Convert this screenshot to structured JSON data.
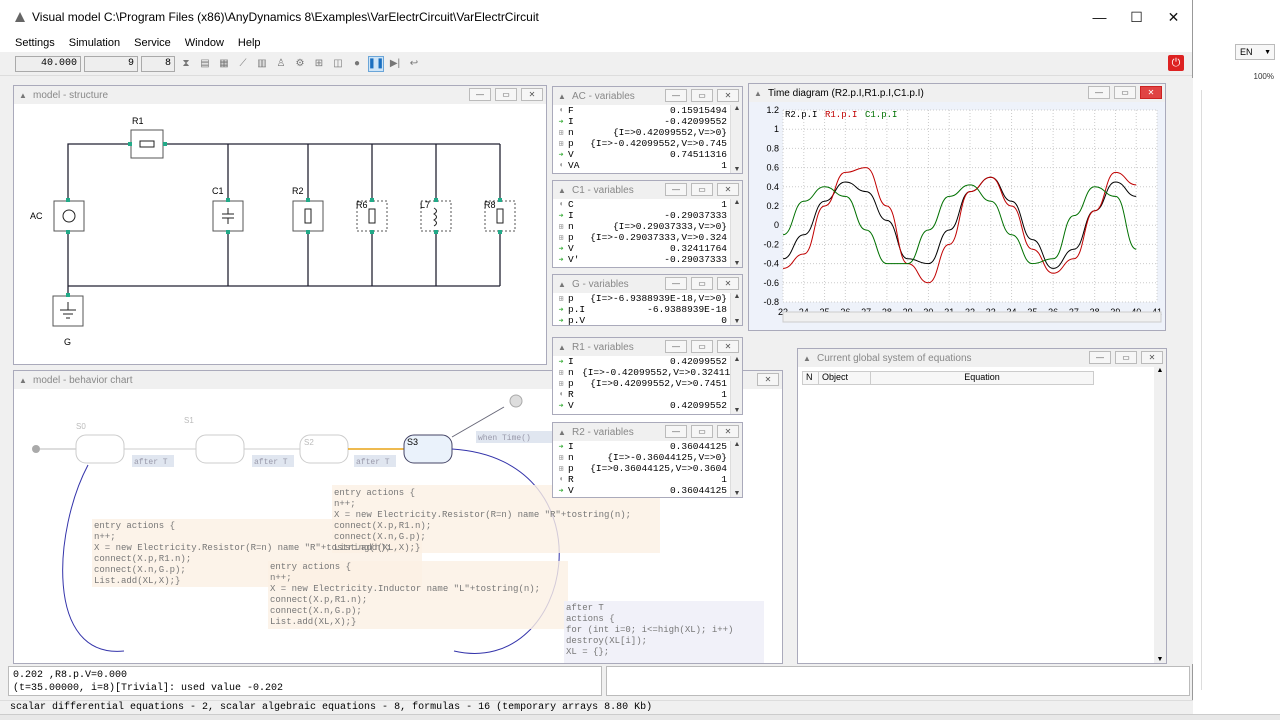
{
  "app": {
    "title": "Visual model C:\\Program Files (x86)\\AnyDynamics 8\\Examples\\VarElectrCircuit\\VarElectrCircuit"
  },
  "window_controls": {
    "minimize": "—",
    "maximize": "☐",
    "close": "✕"
  },
  "menu": [
    "Settings",
    "Simulation",
    "Service",
    "Window",
    "Help"
  ],
  "toolbar": {
    "time": "40.000",
    "field2": "9",
    "field3": "8"
  },
  "structure": {
    "title": "model - structure",
    "components": {
      "r1": "R1",
      "ac": "AC",
      "c1": "C1",
      "r2": "R2",
      "r6": "R6",
      "l7": "L7",
      "r8": "R8",
      "g": "G"
    }
  },
  "behavior": {
    "title": "model - behavior chart",
    "states": [
      "S0",
      "S1",
      "S2",
      "S3"
    ],
    "transitions": [
      "after T",
      "after T",
      "after T",
      "when Time()"
    ],
    "code1": [
      "entry actions {",
      "    n++;",
      "    X = new Electricity.Resistor(R=n) name \"R\"+tostring(n);",
      "    connect(X.p,R1.n);",
      "    connect(X.n,G.p);",
      "    List.add(XL,X);}"
    ],
    "code2": [
      "entry actions {",
      "    n++;",
      "    X = new Electricity.Resistor(R=n) name \"R\"+tostring(n);",
      "    connect(X.p,R1.n);",
      "    connect(X.n,G.p);",
      "    List.add(XL,X);}"
    ],
    "code3": [
      "entry actions {",
      "    n++;",
      "    X = new Electricity.Inductor name \"L\"+tostring(n);",
      "    connect(X.p,R1.n);",
      "    connect(X.n,G.p);",
      "    List.add(XL,X);}"
    ],
    "code4": [
      "after T",
      "actions {",
      "   for (int i=0; i<=high(XL); i++)",
      "     destroy(XL[i]);",
      "   XL = {};"
    ]
  },
  "var_windows": [
    {
      "title": "AC - variables",
      "rows": [
        {
          "icon": "grey",
          "name": "F",
          "value": "0.15915494"
        },
        {
          "icon": "green",
          "name": "I",
          "value": "-0.42099552"
        },
        {
          "icon": "plus",
          "name": "n",
          "value": "{I=>0.42099552,V=>0}"
        },
        {
          "icon": "plus",
          "name": "p",
          "value": "{I=>-0.42099552,V=>0.745"
        },
        {
          "icon": "green",
          "name": "V",
          "value": "0.74511316"
        },
        {
          "icon": "grey",
          "name": "VA",
          "value": "1"
        }
      ]
    },
    {
      "title": "C1 - variables",
      "rows": [
        {
          "icon": "grey",
          "name": "C",
          "value": "1"
        },
        {
          "icon": "green",
          "name": "I",
          "value": "-0.29037333"
        },
        {
          "icon": "plus",
          "name": "n",
          "value": "{I=>0.29037333,V=>0}"
        },
        {
          "icon": "plus",
          "name": "p",
          "value": "{I=>-0.29037333,V=>0.324"
        },
        {
          "icon": "green",
          "name": "V",
          "value": "0.32411764"
        },
        {
          "icon": "green",
          "name": "V'",
          "value": "-0.29037333"
        }
      ]
    },
    {
      "title": "G - variables",
      "rows": [
        {
          "icon": "plus",
          "name": "p",
          "value": "{I=>-6.9388939E-18,V=>0}"
        },
        {
          "icon": "green",
          "name": "p.I",
          "value": "-6.9388939E-18"
        },
        {
          "icon": "green",
          "name": "p.V",
          "value": "0"
        }
      ]
    },
    {
      "title": "R1 - variables",
      "rows": [
        {
          "icon": "green",
          "name": "I",
          "value": "0.42099552"
        },
        {
          "icon": "plus",
          "name": "n",
          "value": "{I=>-0.42099552,V=>0.32411"
        },
        {
          "icon": "plus",
          "name": "p",
          "value": "{I=>0.42099552,V=>0.7451"
        },
        {
          "icon": "grey",
          "name": "R",
          "value": "1"
        },
        {
          "icon": "green",
          "name": "V",
          "value": "0.42099552"
        }
      ]
    },
    {
      "title": "R2 - variables",
      "rows": [
        {
          "icon": "green",
          "name": "I",
          "value": "0.36044125"
        },
        {
          "icon": "plus",
          "name": "n",
          "value": "{I=>-0.36044125,V=>0}"
        },
        {
          "icon": "plus",
          "name": "p",
          "value": "{I=>0.36044125,V=>0.3604"
        },
        {
          "icon": "grey",
          "name": "R",
          "value": "1"
        },
        {
          "icon": "green",
          "name": "V",
          "value": "0.36044125"
        }
      ]
    }
  ],
  "time_diagram": {
    "title": "Time diagram (R2.p.I,R1.p.I,C1.p.I)"
  },
  "chart_data": {
    "type": "line",
    "legend": [
      "R2.p.I",
      "R1.p.I",
      "C1.p.I"
    ],
    "legend_placement": "top-left",
    "xlim": [
      23,
      41
    ],
    "ylim": [
      -0.8,
      1.2
    ],
    "x_ticks": [
      23,
      24,
      25,
      26,
      27,
      28,
      29,
      30,
      31,
      32,
      33,
      34,
      35,
      36,
      37,
      38,
      39,
      40,
      41
    ],
    "y_ticks": [
      "1.2",
      "1",
      "0.8",
      "0.6",
      "0.4",
      "0.2",
      "0",
      "-0.2",
      "-0.4",
      "-0.6",
      "-0.8"
    ],
    "grid": true,
    "series": [
      {
        "name": "R2.p.I",
        "color": "#000000",
        "x": [
          23,
          24,
          25,
          26,
          27,
          28,
          29,
          30,
          31,
          32,
          33,
          34,
          35,
          36,
          37,
          38,
          39,
          40
        ],
        "y": [
          -0.35,
          -0.1,
          0.25,
          0.45,
          0.35,
          0.05,
          -0.35,
          -0.4,
          -0.05,
          0.35,
          0.5,
          0.25,
          -0.15,
          -0.45,
          -0.25,
          0.15,
          0.45,
          0.3
        ]
      },
      {
        "name": "R1.p.I",
        "color": "#c00000",
        "x": [
          23,
          24,
          25,
          26,
          27,
          28,
          29,
          30,
          31,
          32,
          33,
          34,
          35,
          36,
          37,
          38,
          39,
          40
        ],
        "y": [
          -0.45,
          -0.3,
          0.2,
          0.55,
          0.6,
          0.2,
          -0.4,
          -0.6,
          -0.2,
          0.35,
          0.5,
          0.2,
          -0.25,
          -0.5,
          -0.35,
          0.15,
          0.55,
          0.42
        ]
      },
      {
        "name": "C1.p.I",
        "color": "#007000",
        "x": [
          23,
          24,
          25,
          26,
          27,
          28,
          29,
          30,
          31,
          32,
          33,
          34,
          35,
          36,
          37,
          38,
          39,
          40
        ],
        "y": [
          -0.1,
          0.25,
          0.4,
          0.3,
          -0.05,
          -0.4,
          -0.4,
          -0.05,
          0.3,
          0.42,
          0.25,
          -0.1,
          -0.4,
          -0.35,
          0.1,
          0.4,
          0.3,
          -0.25
        ]
      }
    ]
  },
  "equations": {
    "title": "Current global system of equations",
    "columns": [
      "N",
      "Object",
      "Equation"
    ]
  },
  "output": {
    "line1": "0.202 ,R8.p.V=0.000",
    "line2": "(t=35.00000, i=8)[Trivial]:  used value -0.202"
  },
  "status": "scalar differential equations - 2, scalar algebraic equations - 8, formulas - 16 (temporary arrays 8.80 Kb)",
  "bg_app": {
    "lang": "EN",
    "zoom": "100%"
  }
}
